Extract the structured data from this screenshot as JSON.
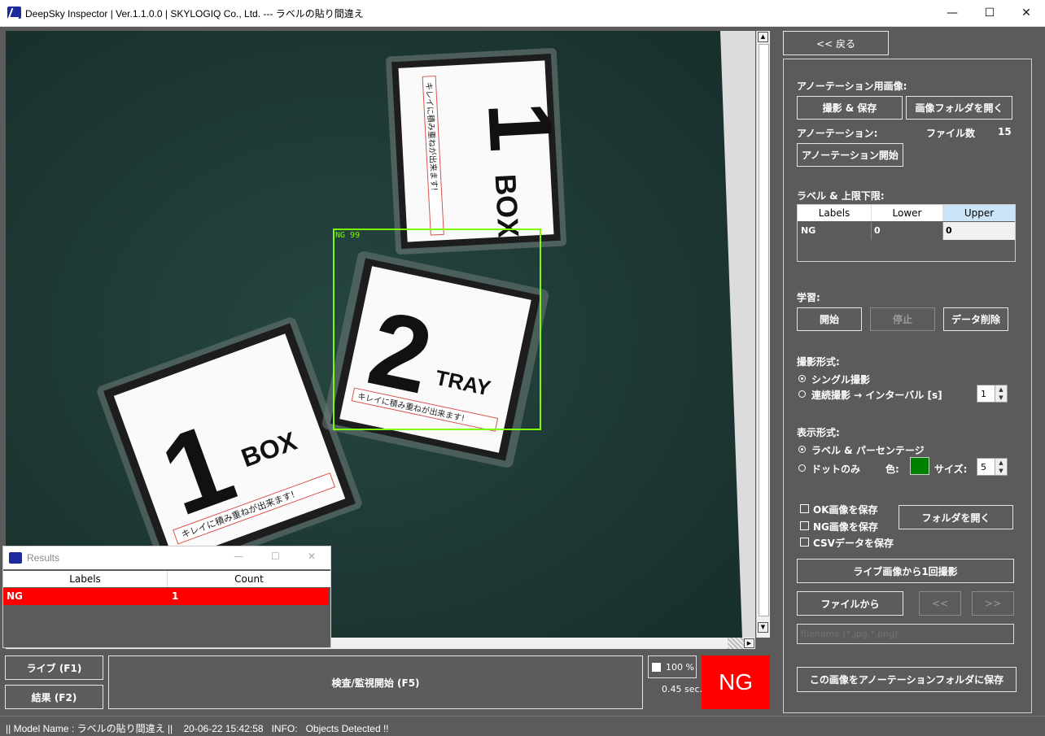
{
  "window": {
    "title": "DeepSky Inspector | Ver.1.1.0.0 | SKYLOGIQ Co., Ltd. --- ラベルの貼り間違え",
    "minimize": "—",
    "maximize": "☐",
    "close": "✕"
  },
  "viewer": {
    "detection_label": "NG 99",
    "cube1": {
      "number": "1",
      "word": "BOX",
      "strip": "キレイに積み重ねが出来ます!"
    },
    "cube2": {
      "number": "1",
      "word": "BOX",
      "strip": "キレイに積み重ねが出来ます!"
    },
    "cube3": {
      "number": "2",
      "word": "TRAY",
      "strip": "キレイに積み重ねが出来ます!"
    }
  },
  "results_window": {
    "title": "Results",
    "columns": [
      "Labels",
      "Count"
    ],
    "rows": [
      {
        "label": "NG",
        "count": "1"
      }
    ]
  },
  "bottom": {
    "live_button": "ライブ (F1)",
    "result_button": "結果 (F2)",
    "inspect_button": "検査/監視開始 (F5)",
    "zoom_label": "100 %",
    "time_label": "0.45 sec.",
    "verdict": "NG",
    "verdict_color": "#ff0000"
  },
  "panel": {
    "back_button": "<< 戻る",
    "annotation_images_heading": "アノーテーション用画像:",
    "capture_save_button": "撮影 & 保存",
    "open_image_folder_button": "画像フォルダを開く",
    "annotation_label": "アノーテーション:",
    "file_count_label": "ファイル数",
    "file_count_value": "15",
    "annotation_start_button": "アノーテーション開始",
    "limits_heading": "ラベル & 上限下限:",
    "limits_columns": [
      "Labels",
      "Lower",
      "Upper"
    ],
    "limits_rows": [
      {
        "label": "NG",
        "lower": "0",
        "upper": "0"
      }
    ],
    "learning_heading": "学習:",
    "start_button": "開始",
    "stop_button": "停止",
    "delete_data_button": "データ削除",
    "capture_mode_heading": "撮影形式:",
    "single_capture_label": "シングル撮影",
    "continuous_capture_label": "連続撮影 → インターバル [s]",
    "interval_value": "1",
    "display_mode_heading": "表示形式:",
    "label_percent_label": "ラベル & パーセンテージ",
    "dot_only_label": "ドットのみ",
    "color_label": "色:",
    "dot_color": "#008000",
    "size_label": "サイズ:",
    "size_value": "5",
    "save_ok_label": "OK画像を保存",
    "save_ng_label": "NG画像を保存",
    "save_csv_label": "CSVデータを保存",
    "open_folder_button": "フォルダを開く",
    "live_capture_button": "ライブ画像から1回撮影",
    "from_file_button": "ファイルから",
    "prev_button": "<<",
    "next_button": ">>",
    "filename_placeholder": "filename (*.jpg,*.png)",
    "save_to_annotation_button": "この画像をアノーテーションフォルダに保存"
  },
  "status_bar": {
    "text": "|| Model Name : ラベルの貼り間違え ||    20-06-22 15:42:58   INFO:   Objects Detected !!"
  }
}
